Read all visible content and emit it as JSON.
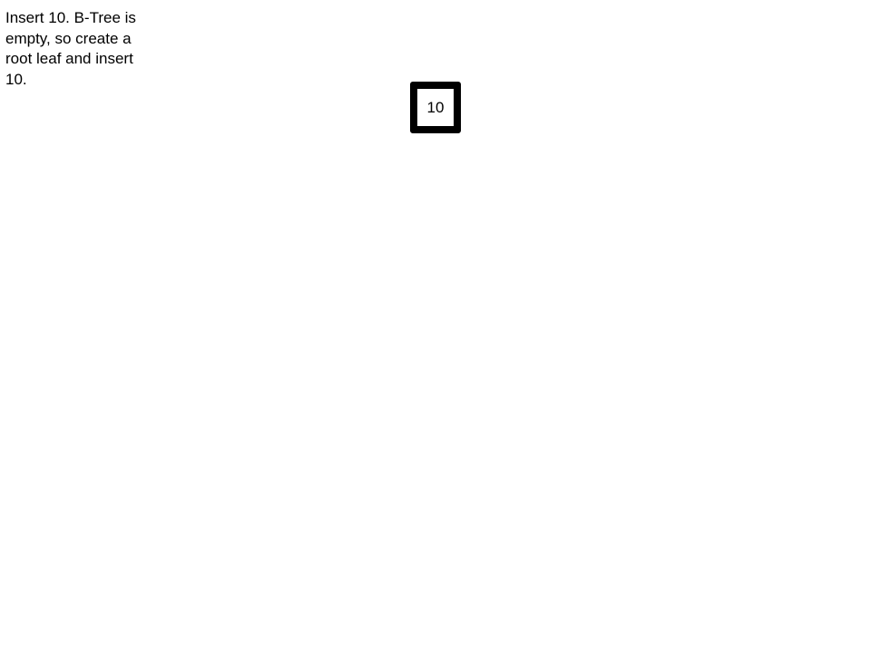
{
  "description": {
    "text": "Insert 10. B-Tree is empty, so create a root leaf and insert 10."
  },
  "tree": {
    "root": {
      "keys": [
        "10"
      ]
    }
  },
  "colors": {
    "node_border": "#000000",
    "background": "#ffffff",
    "text": "#000000"
  }
}
